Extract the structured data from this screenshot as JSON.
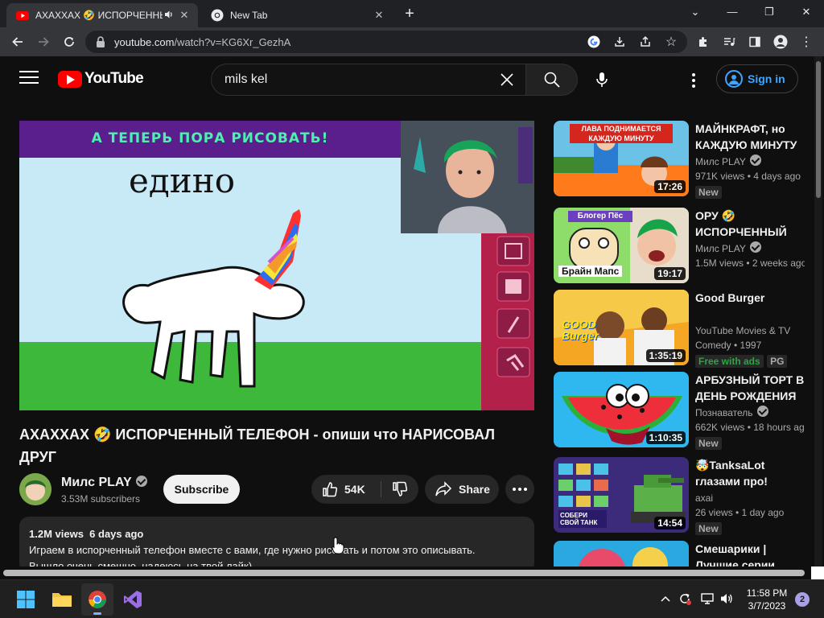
{
  "browser": {
    "tabs": [
      {
        "title": "АХАХХАХ 🤣 ИСПОРЧЕННЫЙ ТЕЛЕФОН",
        "active": true,
        "favicon": "youtube-icon",
        "audio": true
      },
      {
        "title": "New Tab",
        "active": false,
        "favicon": "chrome-icon"
      }
    ],
    "url_domain": "youtube.com",
    "url_path": "/watch?v=KG6Xr_GezhA"
  },
  "youtube": {
    "logo_text": "YouTube",
    "search_query": "mils kel",
    "signin_label": "Sign in"
  },
  "player": {
    "banner_text": "А ТЕПЕРЬ ПОРА РИСОВАТЬ!",
    "drawing_word": "едино"
  },
  "video": {
    "title": "АХАХХАХ 🤣 ИСПОРЧЕННЫЙ ТЕЛЕФОН - опиши что НАРИСОВАЛ ДРУГ",
    "channel_name": "Милс PLAY",
    "subscribers": "3.53M subscribers",
    "subscribe_label": "Subscribe",
    "likes": "54K",
    "share_label": "Share",
    "views": "1.2M views",
    "date": "6 days ago",
    "description_line1": "Играем в испорченный телефон вместе с вами, где нужно рисовать и потом это описывать.",
    "description_line2": "Вышло очень смешно, надеюсь на твой лайк)"
  },
  "recommendations": [
    {
      "title": "МАЙНКРАФТ, но КАЖДУЮ МИНУТУ ЛАВА",
      "channel": "Милс PLAY",
      "verified": true,
      "stats": "971K views • 4 days ago",
      "badge": "New",
      "duration": "17:26",
      "thumb_text": "ЛАВА ПОДНИМАЕТСЯ КАЖДУЮ МИНУТУ"
    },
    {
      "title": "ОРУ 🤣 ИСПОРЧЕННЫЙ ТЕЛЕФОН",
      "channel": "Милс PLAY",
      "verified": true,
      "stats": "1.5M views • 2 weeks ago",
      "badge": "",
      "duration": "19:17",
      "thumb_text_top": "Блогер Пёс",
      "thumb_text_bottom": "Брайн Мапс"
    },
    {
      "title": "Good Burger",
      "channel": "YouTube Movies & TV",
      "verified": false,
      "stats": "Comedy • 1997",
      "badge": "Free with ads",
      "badge2": "PG",
      "duration": "1:35:19",
      "thumb_text": "GOOD Burger"
    },
    {
      "title": "АРБУЗНЫЙ ТОРТ В ДЕНЬ РОЖДЕНИЯ",
      "channel": "Познаватель",
      "verified": true,
      "stats": "662K views • 18 hours ago",
      "badge": "New",
      "duration": "1:10:35"
    },
    {
      "title": "🤯TanksaLot глазами про! ТАНКИ",
      "channel": "axai",
      "verified": false,
      "stats": "26 views • 1 day ago",
      "badge": "New",
      "duration": "14:54",
      "thumb_text": "СОБЕРИ СВОЙ ТАНК"
    },
    {
      "title": "Смешарики | Лучшие серии",
      "channel": "",
      "verified": false,
      "stats": "",
      "badge": "",
      "duration": ""
    }
  ],
  "taskbar": {
    "time": "11:58 PM",
    "date": "3/7/2023",
    "notifications": "2"
  }
}
